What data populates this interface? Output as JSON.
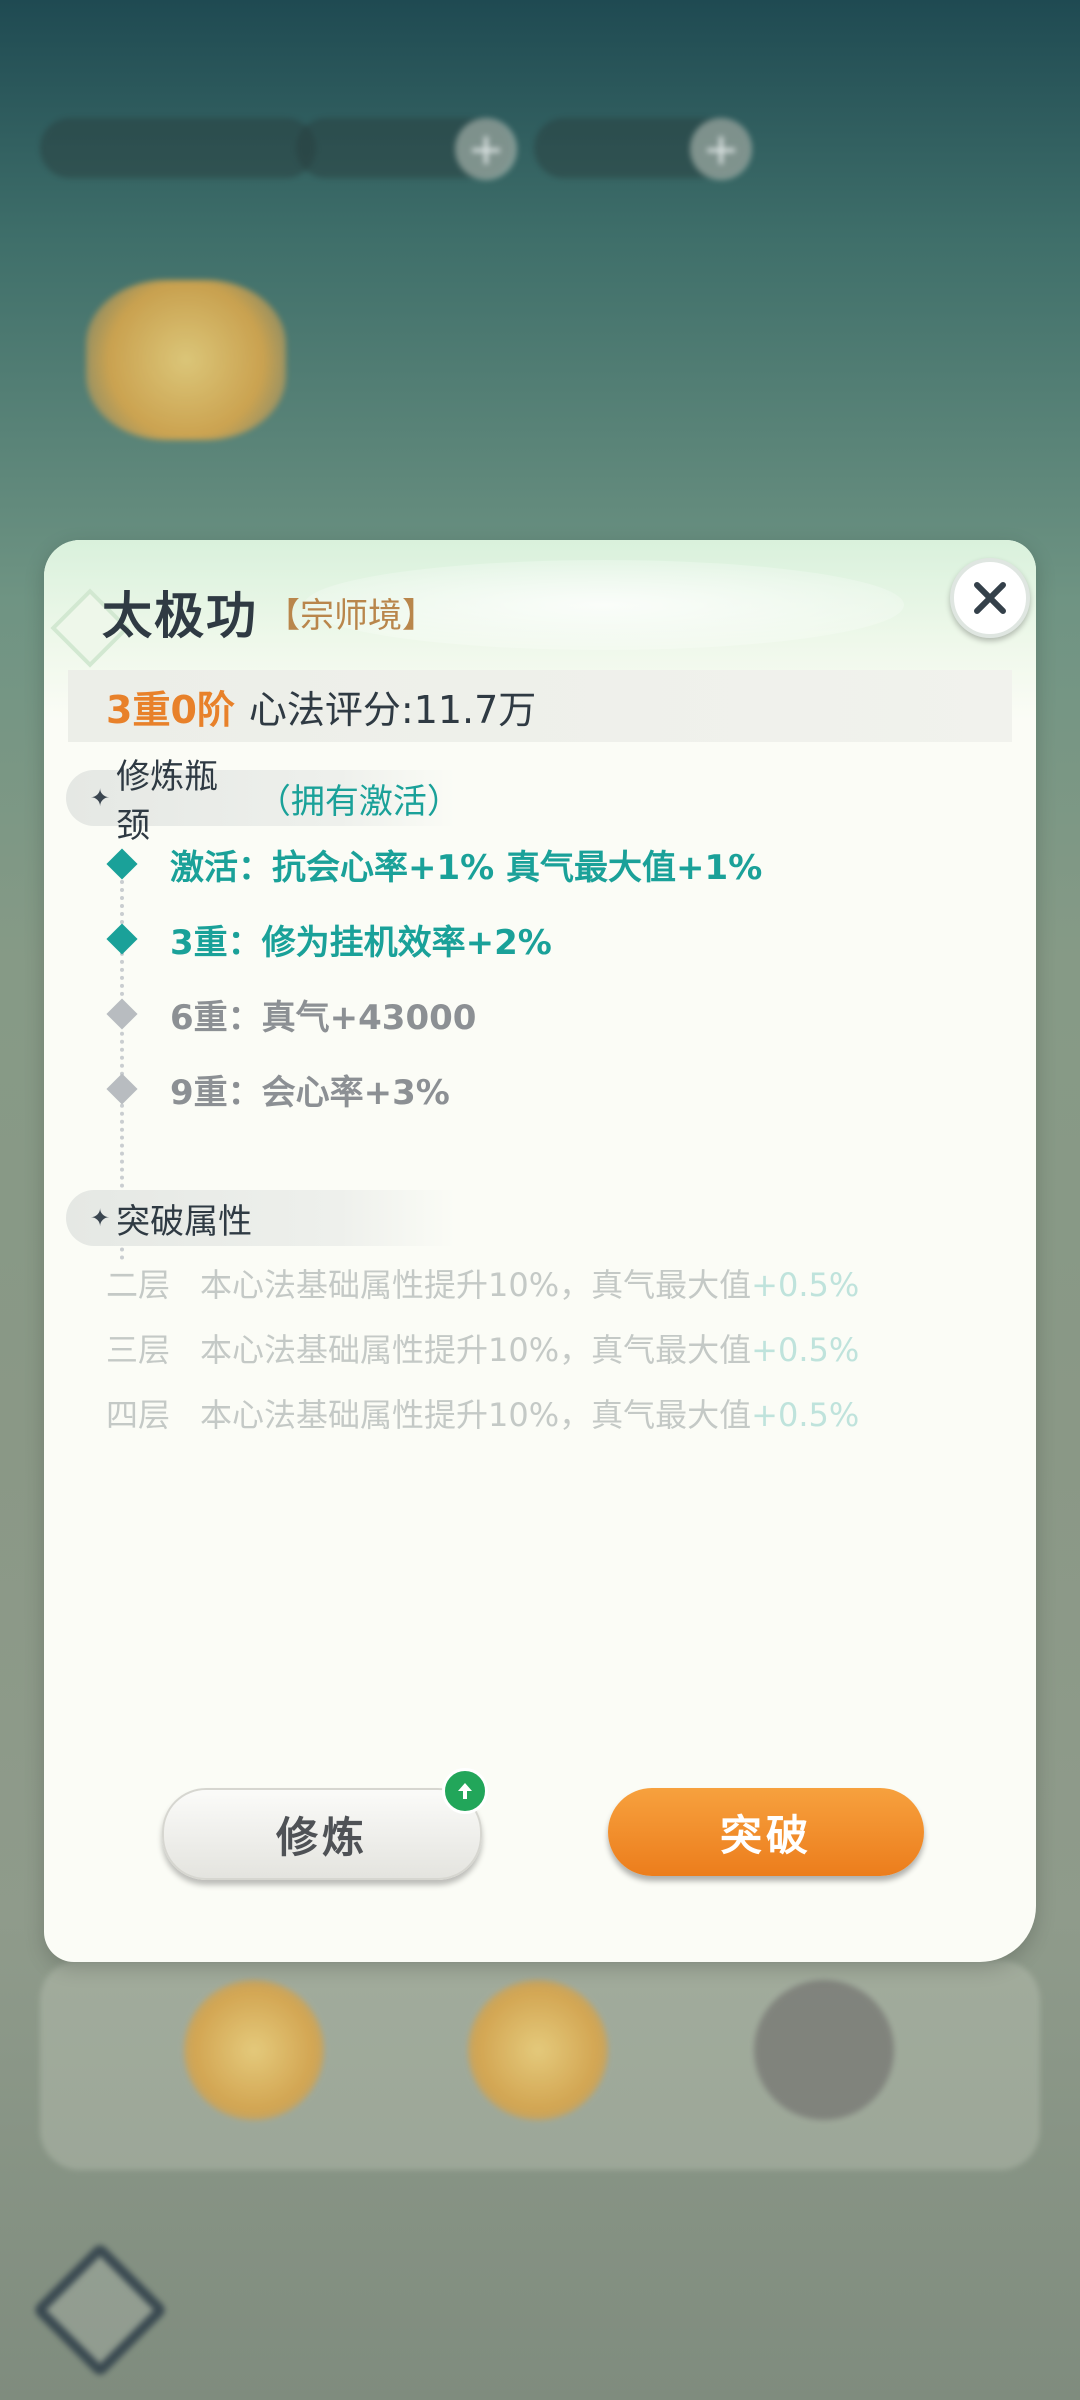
{
  "background": {
    "resources": [
      {
        "name": "",
        "value": ""
      },
      {
        "name": "",
        "value": ""
      },
      {
        "name": "",
        "value": ""
      }
    ]
  },
  "dialog": {
    "title": "太极功",
    "realm": "【宗师境】",
    "level": "3重0阶",
    "score_label": "心法评分:11.7万",
    "bottleneck": {
      "heading": "修炼瓶颈",
      "status": "（拥有激活）",
      "tiers": [
        {
          "text": "激活：抗会心率+1%  真气最大值+1%",
          "active": true
        },
        {
          "text": "3重：修为挂机效率+2%",
          "active": true
        },
        {
          "text": "6重：真气+43000",
          "active": false
        },
        {
          "text": "9重：会心率+3%",
          "active": false
        }
      ]
    },
    "breakthrough": {
      "heading": "突破属性",
      "rows": [
        {
          "layer": "二层",
          "desc": "本心法基础属性提升10%，真气最大值",
          "bonus": "+0.5%"
        },
        {
          "layer": "三层",
          "desc": "本心法基础属性提升10%，真气最大值",
          "bonus": "+0.5%"
        },
        {
          "layer": "四层",
          "desc": "本心法基础属性提升10%，真气最大值",
          "bonus": "+0.5%"
        }
      ]
    },
    "buttons": {
      "practice": "修炼",
      "breakthrough": "突破"
    },
    "icons": {
      "close": "close-icon",
      "upgrade": "arrow-up-icon"
    }
  },
  "colors": {
    "accent_teal": "#1aa199",
    "accent_orange": "#e8812a",
    "realm_gold": "#b9864b",
    "inactive_gray": "#8c9094"
  }
}
